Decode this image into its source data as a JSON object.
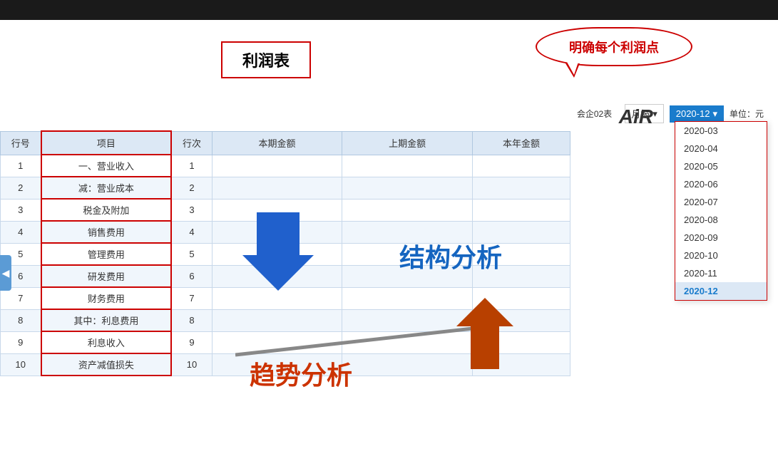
{
  "topBar": {},
  "callout": {
    "text": "明确每个利润点"
  },
  "titleBox": {
    "text": "利润表"
  },
  "controls": {
    "companyLabel": "会企02表",
    "periodType": "月报",
    "chevron": "▾",
    "selectedPeriod": "2020-12",
    "unitLabel": "单位：元"
  },
  "table": {
    "headers": [
      "行号",
      "项目",
      "行次",
      "本期金额",
      "上期金额",
      "本年金额"
    ],
    "rows": [
      {
        "hang": "1",
        "xiangmu": "一、营业收入",
        "ci": "1",
        "bq": "",
        "sq": "",
        "bn": ""
      },
      {
        "hang": "2",
        "xiangmu": "减：营业成本",
        "ci": "2",
        "bq": "",
        "sq": "",
        "bn": ""
      },
      {
        "hang": "3",
        "xiangmu": "税金及附加",
        "ci": "3",
        "bq": "",
        "sq": "",
        "bn": ""
      },
      {
        "hang": "4",
        "xiangmu": "销售费用",
        "ci": "4",
        "bq": "",
        "sq": "",
        "bn": ""
      },
      {
        "hang": "5",
        "xiangmu": "管理费用",
        "ci": "5",
        "bq": "",
        "sq": "",
        "bn": ""
      },
      {
        "hang": "6",
        "xiangmu": "研发费用",
        "ci": "6",
        "bq": "",
        "sq": "",
        "bn": ""
      },
      {
        "hang": "7",
        "xiangmu": "财务费用",
        "ci": "7",
        "bq": "",
        "sq": "",
        "bn": ""
      },
      {
        "hang": "8",
        "xiangmu": "其中：利息费用",
        "ci": "8",
        "bq": "",
        "sq": "",
        "bn": ""
      },
      {
        "hang": "9",
        "xiangmu": "利息收入",
        "ci": "9",
        "bq": "",
        "sq": "",
        "bn": ""
      },
      {
        "hang": "10",
        "xiangmu": "资产减值损失",
        "ci": "10",
        "bq": "",
        "sq": "",
        "bn": ""
      }
    ]
  },
  "dropdown": {
    "items": [
      {
        "value": "2020-03",
        "label": "2020-03"
      },
      {
        "value": "2020-04",
        "label": "2020-04"
      },
      {
        "value": "2020-05",
        "label": "2020-05"
      },
      {
        "value": "2020-06",
        "label": "2020-06"
      },
      {
        "value": "2020-07",
        "label": "2020-07"
      },
      {
        "value": "2020-08",
        "label": "2020-08"
      },
      {
        "value": "2020-09",
        "label": "2020-09"
      },
      {
        "value": "2020-10",
        "label": "2020-10"
      },
      {
        "value": "2020-11",
        "label": "2020-11"
      },
      {
        "value": "2020-12",
        "label": "2020-12",
        "selected": true
      }
    ]
  },
  "overlays": {
    "jiegouText": "结构分析",
    "qushiText": "趋势分析"
  },
  "airText": "AiR",
  "leftTab": "◀"
}
